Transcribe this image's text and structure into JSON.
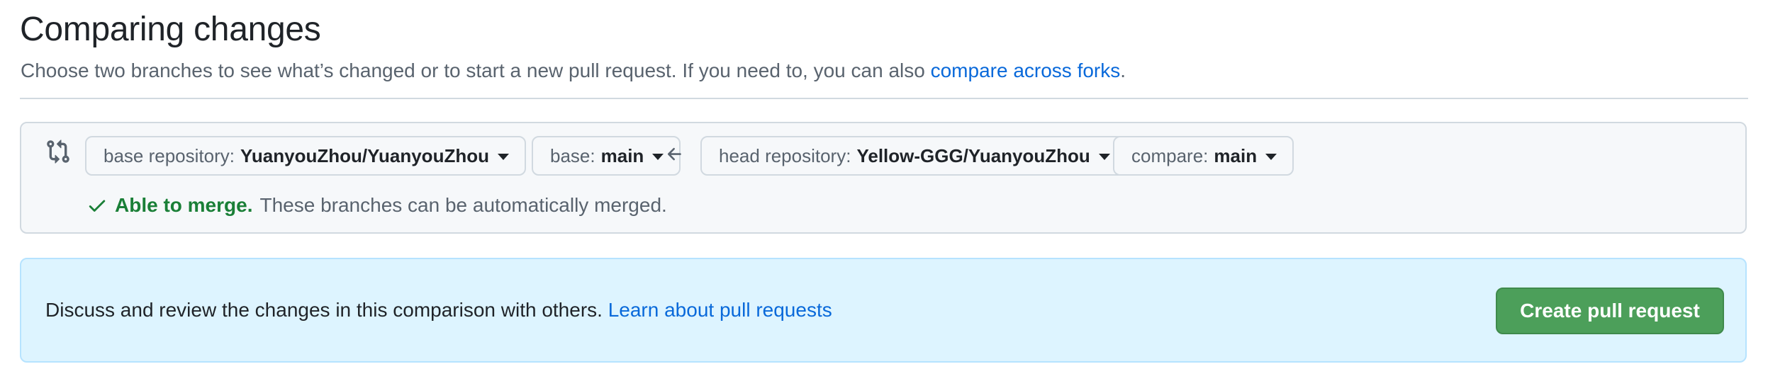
{
  "header": {
    "title": "Comparing changes",
    "subtitle_text": "Choose two branches to see what’s changed or to start a new pull request. If you need to, you can also ",
    "subtitle_link": "compare across forks",
    "subtitle_end": "."
  },
  "compare": {
    "icon": "git-compare-icon",
    "base_repo": {
      "label": "base repository:",
      "value": "YuanyouZhou/YuanyouZhou"
    },
    "base": {
      "label": "base:",
      "value": "main"
    },
    "arrow_icon": "arrow-left-icon",
    "head_repo": {
      "label": "head repository:",
      "value": "Yellow-GGG/YuanyouZhou"
    },
    "compare": {
      "label": "compare:",
      "value": "main"
    },
    "merge_status": {
      "icon": "check-icon",
      "title": "Able to merge.",
      "description": "These branches can be automatically merged."
    }
  },
  "info": {
    "text": "Discuss and review the changes in this comparison with others. ",
    "link": "Learn about pull requests",
    "button_label": "Create pull request"
  },
  "colors": {
    "link": "#0969da",
    "success": "#1a7f37",
    "button_green": "#4c9f5a",
    "info_bg": "#ddf4ff"
  }
}
